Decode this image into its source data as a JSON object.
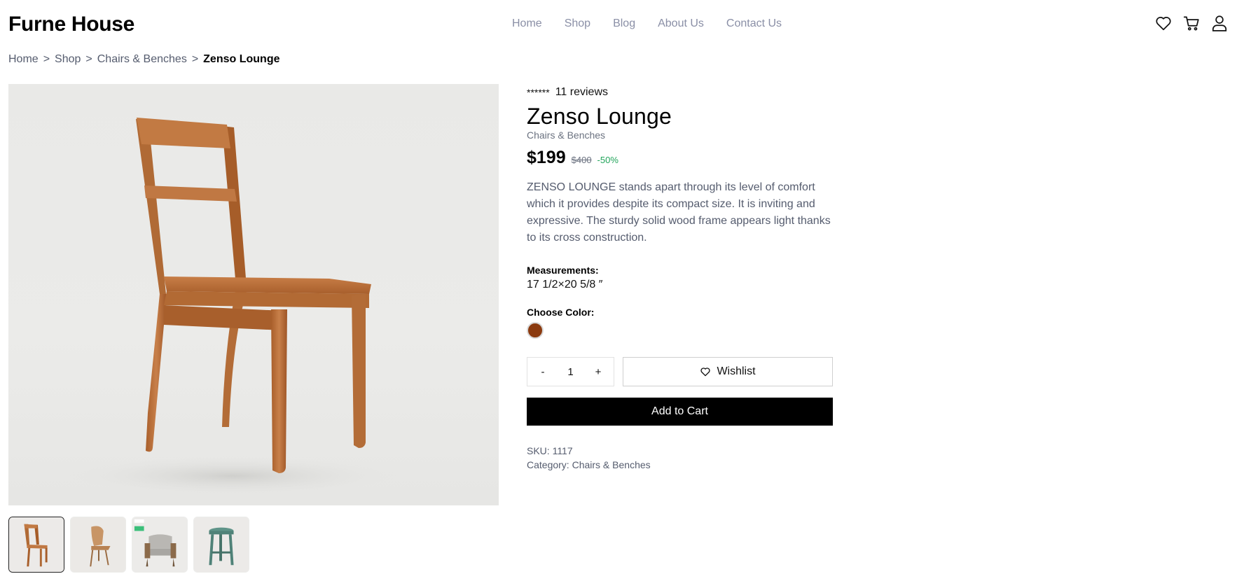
{
  "brand": {
    "logo": "Furne House"
  },
  "nav": {
    "items": [
      {
        "label": "Home"
      },
      {
        "label": "Shop"
      },
      {
        "label": "Blog"
      },
      {
        "label": "About Us"
      },
      {
        "label": "Contact Us"
      }
    ]
  },
  "header_icons": [
    "heart-icon",
    "cart-icon",
    "user-icon"
  ],
  "breadcrumb": {
    "items": [
      {
        "label": "Home"
      },
      {
        "label": "Shop"
      },
      {
        "label": "Chairs & Benches"
      }
    ],
    "current": "Zenso Lounge",
    "separator": ">"
  },
  "product": {
    "rating_stars": "******",
    "reviews": "11 reviews",
    "title": "Zenso Lounge",
    "subcategory": "Chairs & Benches",
    "price": "$199",
    "old_price": "$400",
    "discount": "-50%",
    "description": "ZENSO LOUNGE stands apart through its level of comfort which it provides despite its compact size. It is inviting and expressive. The sturdy solid wood frame appears light thanks to its cross construction.",
    "measurements_label": "Measurements:",
    "measurements_value": "17 1/2×20 5/8 ″",
    "color_label": "Choose Color:",
    "colors": [
      "#8b3a0f"
    ],
    "quantity": {
      "minus": "-",
      "value": "1",
      "plus": "+"
    },
    "wishlist_label": "Wishlist",
    "add_to_cart_label": "Add to Cart",
    "sku": "SKU: 1117",
    "category": "Category: Chairs & Benches"
  },
  "thumbnails": [
    {
      "name": "thumb-wood-chair",
      "active": true
    },
    {
      "name": "thumb-bent-chair",
      "active": false
    },
    {
      "name": "thumb-armchair",
      "active": false
    },
    {
      "name": "thumb-stool",
      "active": false
    }
  ],
  "colors": {
    "accent_green": "#22a55b",
    "nav_gray": "#8a8fa6",
    "button_black": "#000000"
  }
}
